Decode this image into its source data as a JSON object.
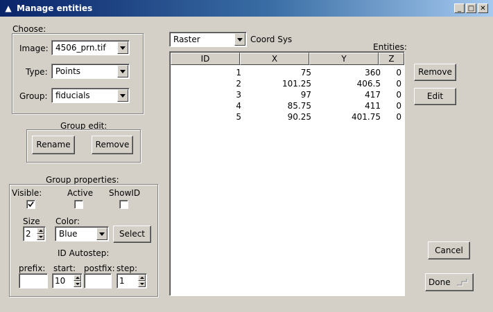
{
  "window": {
    "title": "Manage entities"
  },
  "choose": {
    "label": "Choose:",
    "image_label": "Image:",
    "image_value": "4506_prn.tif",
    "type_label": "Type:",
    "type_value": "Points",
    "group_label": "Group:",
    "group_value": "fiducials"
  },
  "group_edit": {
    "label": "Group edit:",
    "rename": "Rename",
    "remove": "Remove"
  },
  "group_props": {
    "label": "Group properties:",
    "visible_label": "Visible:",
    "visible": true,
    "active_label": "Active",
    "active": false,
    "showid_label": "ShowID",
    "showid": false,
    "size_label": "Size",
    "size_value": "2",
    "color_label": "Color:",
    "color_value": "Blue",
    "select_label": "Select",
    "autostep_label": "ID Autostep:",
    "prefix_label": "prefix:",
    "prefix_value": "",
    "start_label": "start:",
    "start_value": "10",
    "postfix_label": "postfix:",
    "postfix_value": "",
    "step_label": "step:",
    "step_value": "1"
  },
  "coords": {
    "system": "Raster",
    "label": "Coord Sys"
  },
  "entities": {
    "label": "Entities:",
    "columns": [
      "ID",
      "X",
      "Y",
      "Z"
    ],
    "rows": [
      [
        "1",
        "75",
        "360",
        "0"
      ],
      [
        "2",
        "101.25",
        "406.5",
        "0"
      ],
      [
        "3",
        "97",
        "417",
        "0"
      ],
      [
        "4",
        "85.75",
        "411",
        "0"
      ],
      [
        "5",
        "90.25",
        "401.75",
        "0"
      ]
    ]
  },
  "actions": {
    "remove": "Remove",
    "edit": "Edit",
    "cancel": "Cancel",
    "done": "Done"
  }
}
